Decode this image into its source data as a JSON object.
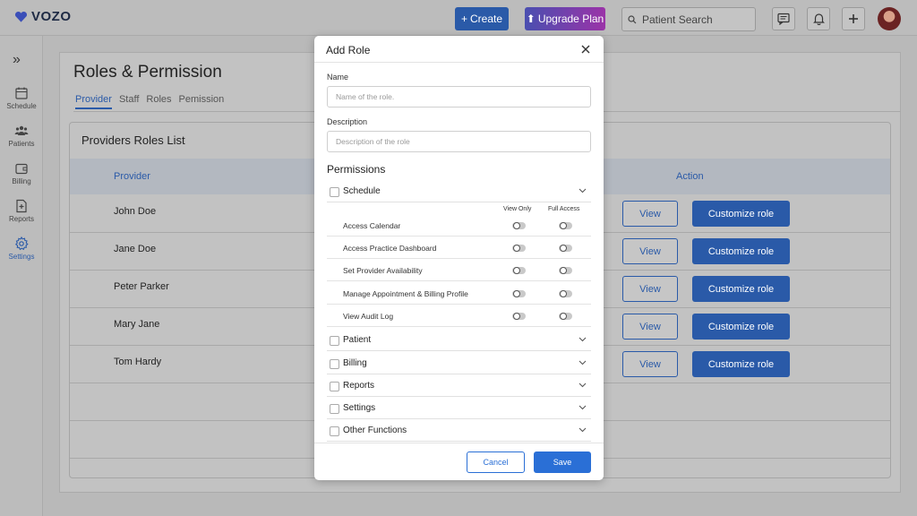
{
  "app": {
    "logo": "VOZO"
  },
  "topbar": {
    "create_label": "Create",
    "upgrade_label": "Upgrade Plan",
    "search_placeholder": "Patient Search"
  },
  "sidebar": {
    "items": [
      {
        "label": "Schedule",
        "icon": "calendar-icon"
      },
      {
        "label": "Patients",
        "icon": "users-icon"
      },
      {
        "label": "Billing",
        "icon": "wallet-icon"
      },
      {
        "label": "Reports",
        "icon": "report-icon"
      },
      {
        "label": "Settings",
        "icon": "gear-icon",
        "active": true
      }
    ]
  },
  "page": {
    "title": "Roles & Permission",
    "tabs": [
      "Provider",
      "Staff",
      "Roles",
      "Pemission"
    ],
    "active_tab": "Provider",
    "list_title": "Providers Roles List",
    "columns": {
      "provider": "Provider",
      "action": "Action"
    },
    "rows": [
      {
        "name": "John Doe",
        "view": "View",
        "customize": "Customize role"
      },
      {
        "name": "Jane Doe",
        "view": "View",
        "customize": "Customize role"
      },
      {
        "name": "Peter Parker",
        "view": "View",
        "customize": "Customize role"
      },
      {
        "name": "Mary Jane",
        "view": "View",
        "customize": "Customize role"
      },
      {
        "name": "Tom Hardy",
        "view": "View",
        "customize": "Customize role"
      }
    ]
  },
  "modal": {
    "title": "Add Role",
    "name_label": "Name",
    "name_placeholder": "Name of the role.",
    "description_label": "Description",
    "description_placeholder": "Description of the role",
    "permissions_title": "Permissions",
    "col_view_only": "View Only",
    "col_full_access": "Full Access",
    "groups": [
      {
        "label": "Schedule",
        "expanded": true
      },
      {
        "label": "Patient"
      },
      {
        "label": "Billing"
      },
      {
        "label": "Reports"
      },
      {
        "label": "Settings"
      },
      {
        "label": "Other Functions"
      }
    ],
    "schedule_permissions": [
      "Access Calendar",
      "Access Practice Dashboard",
      "Set Provider Availability",
      "Manage Appointment & Billing Profile",
      "View Audit Log"
    ],
    "cancel_label": "Cancel",
    "save_label": "Save"
  },
  "colors": {
    "primary": "#2a6fd6",
    "upgrade_gradient": [
      "#4a4fb0",
      "#9b33a8"
    ],
    "overlay": "#bcbcbc"
  }
}
